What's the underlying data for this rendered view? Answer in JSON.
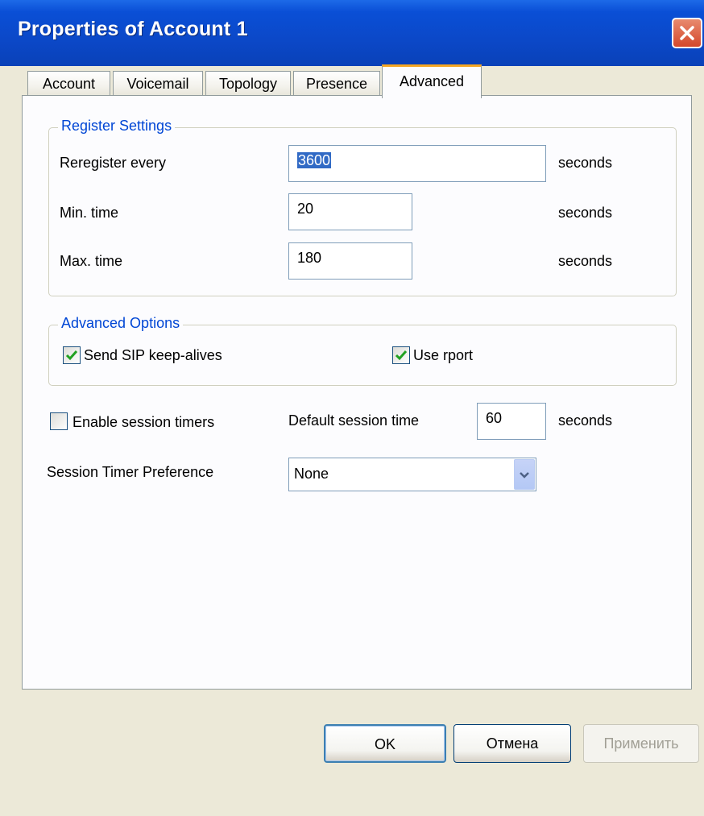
{
  "window": {
    "title": "Properties of Account 1"
  },
  "tabs": [
    {
      "label": "Account"
    },
    {
      "label": "Voicemail"
    },
    {
      "label": "Topology"
    },
    {
      "label": "Presence"
    },
    {
      "label": "Advanced",
      "active": true
    }
  ],
  "register_settings": {
    "legend": "Register Settings",
    "reregister": {
      "label": "Reregister every",
      "value": "3600",
      "unit": "seconds"
    },
    "min_time": {
      "label": "Min. time",
      "value": "20",
      "unit": "seconds"
    },
    "max_time": {
      "label": "Max. time",
      "value": "180",
      "unit": "seconds"
    }
  },
  "advanced_options": {
    "legend": "Advanced Options",
    "keepalives": {
      "label": "Send SIP keep-alives",
      "checked": true
    },
    "rport": {
      "label": "Use rport",
      "checked": true
    }
  },
  "session": {
    "enable_timers": {
      "label": "Enable session timers",
      "checked": false
    },
    "default_time_label": "Default session time",
    "default_time_value": "60",
    "default_time_unit": "seconds",
    "preference_label": "Session Timer Preference",
    "preference_value": "None"
  },
  "buttons": {
    "ok": "OK",
    "cancel": "Отмена",
    "apply": "Применить"
  },
  "colors": {
    "titlebar": "#0a4fd6",
    "legend": "#0046d5",
    "active_tab_accent": "#f5a623",
    "selection": "#316ac5"
  }
}
